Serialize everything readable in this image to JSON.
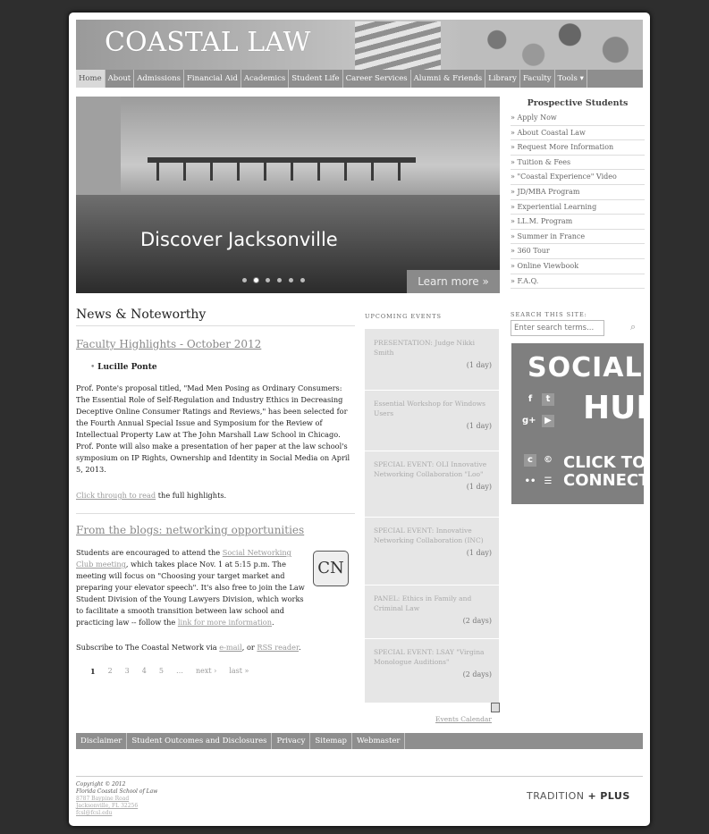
{
  "header": {
    "logo": "COASTAL LAW",
    "nav": [
      "Home",
      "About",
      "Admissions",
      "Financial Aid",
      "Academics",
      "Student Life",
      "Career Services",
      "Alumni & Friends",
      "Library",
      "Faculty",
      "Tools ▾"
    ]
  },
  "hero": {
    "headline": "Discover Jacksonville",
    "learn_more": "Learn more »",
    "slide_count": 6,
    "active_slide": 2
  },
  "sidebar": {
    "title": "Prospective Students",
    "items": [
      "Apply Now",
      "About Coastal Law",
      "Request More Information",
      "Tuition & Fees",
      "\"Coastal Experience\" Video",
      "JD/MBA Program",
      "Experiential Learning",
      "LL.M. Program",
      "Summer in France",
      "360 Tour",
      "Online Viewbook",
      "F.A.Q."
    ]
  },
  "search": {
    "label": "SEARCH THIS SITE:",
    "placeholder": "Enter search terms..."
  },
  "social": {
    "line1": "SOCIAL",
    "line2": "HUB",
    "line3": "CLICK TO",
    "line4": "CONNECT"
  },
  "news": {
    "heading": "News & Noteworthy",
    "article1": {
      "title": "Faculty Highlights - October 2012",
      "person": "Lucille Ponte",
      "body": "Prof. Ponte's proposal titled, \"Mad Men Posing as Ordinary Consumers: The Essential Role of Self-Regulation and Industry Ethics in Decreasing Deceptive Online Consumer Ratings and Reviews,\" has been selected for the Fourth Annual Special Issue and Symposium for the Review of Intellectual Property Law at The John Marshall Law School in Chicago. Prof. Ponte will also make a presentation of her paper at the law school's symposium on IP Rights, Ownership and Identity in Social Media on April 5, 2013.",
      "link": "Click through to read",
      "link_tail": " the full highlights."
    },
    "article2": {
      "title": "From the blogs: networking opportunities",
      "body_a": "Students are encouraged to attend the ",
      "link_a": "Social Networking Club meeting",
      "body_b": ", which takes place Nov. 1 at 5:15 p.m. The meeting will focus on \"Choosing your target market and preparing your elevator speech\". It's also free to join the Law Student Division of the Young Lawyers Division, which works to facilitate a smooth transition between law school and practicing law -- follow the ",
      "link_b": "link for more information",
      "body_c": "."
    },
    "subscribe_a": "Subscribe to The Coastal Network via ",
    "subscribe_email": "e-mail",
    "subscribe_or": ", or ",
    "subscribe_rss": "RSS reader",
    "subscribe_end": ".",
    "cn_badge": "CN",
    "pager": [
      "1",
      "2",
      "3",
      "4",
      "5",
      "…",
      "next ›",
      "last »"
    ]
  },
  "events": {
    "label": "UPCOMING EVENTS",
    "items": [
      {
        "title": "PRESENTATION: Judge Nikki Smith",
        "duration": "(1 day)"
      },
      {
        "title": "Essential Workshop for Windows Users",
        "duration": "(1 day)"
      },
      {
        "title": "SPECIAL EVENT: OLI Innovative Networking Collaboration \"Loo\"",
        "duration": "(1 day)"
      },
      {
        "title": "SPECIAL EVENT: Innovative Networking Collaboration (INC)",
        "duration": "(1 day)"
      },
      {
        "title": "PANEL: Ethics in Family and Criminal Law",
        "duration": "(2 days)"
      },
      {
        "title": "SPECIAL EVENT: LSAY \"Virgina Monologue Auditions\"",
        "duration": "(2 days)"
      }
    ],
    "calendar_link": "Events Calendar"
  },
  "footer": {
    "nav": [
      "Disclaimer",
      "Student Outcomes and Disclosures",
      "Privacy",
      "Sitemap",
      "Webmaster"
    ],
    "copyright": "Copyright © 2012",
    "school": "Florida Coastal School of Law",
    "address1": "8787 Baypine Road",
    "address2": "Jacksonville, FL 32256",
    "url": "fcsl@fcsl.edu",
    "tagline_a": "TRADITION",
    "tagline_plus": "+",
    "tagline_b": "PLUS"
  }
}
